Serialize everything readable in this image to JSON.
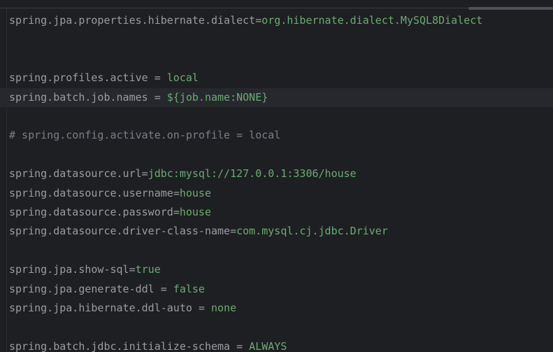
{
  "editor": {
    "lines": [
      {
        "key": "spring.jpa.properties.hibernate.dialect",
        "sep": "=",
        "value": "org.hibernate.dialect.MySQL8Dialect"
      },
      {
        "text": ""
      },
      {
        "text": ""
      },
      {
        "key": "spring.profiles.active",
        "sep": " = ",
        "value": "local"
      },
      {
        "key": "spring.batch.job.names",
        "sep": " = ",
        "value": "${job.name:NONE}",
        "current": true
      },
      {
        "text": ""
      },
      {
        "comment": "# spring.config.activate.on-profile = local"
      },
      {
        "text": ""
      },
      {
        "key": "spring.datasource.url",
        "sep": "=",
        "value": "jdbc:mysql://127.0.0.1:3306/house"
      },
      {
        "key": "spring.datasource.username",
        "sep": "=",
        "value": "house"
      },
      {
        "key": "spring.datasource.password",
        "sep": "=",
        "value": "house"
      },
      {
        "key": "spring.datasource.driver-class-name",
        "sep": "=",
        "value": "com.mysql.cj.jdbc.Driver"
      },
      {
        "text": ""
      },
      {
        "key": "spring.jpa.show-sql",
        "sep": "=",
        "value": "true"
      },
      {
        "key": "spring.jpa.generate-ddl",
        "sep": " = ",
        "value": "false"
      },
      {
        "key": "spring.jpa.hibernate.ddl-auto",
        "sep": " = ",
        "value": "none"
      },
      {
        "text": ""
      },
      {
        "key": "spring.batch.jdbc.initialize-schema",
        "sep": " = ",
        "value": "ALWAYS"
      }
    ]
  },
  "colors": {
    "background": "#1e1f22",
    "key": "#9a9ca2",
    "value": "#6aab73",
    "comment": "#7a7e85",
    "current_line": "#26282e"
  }
}
